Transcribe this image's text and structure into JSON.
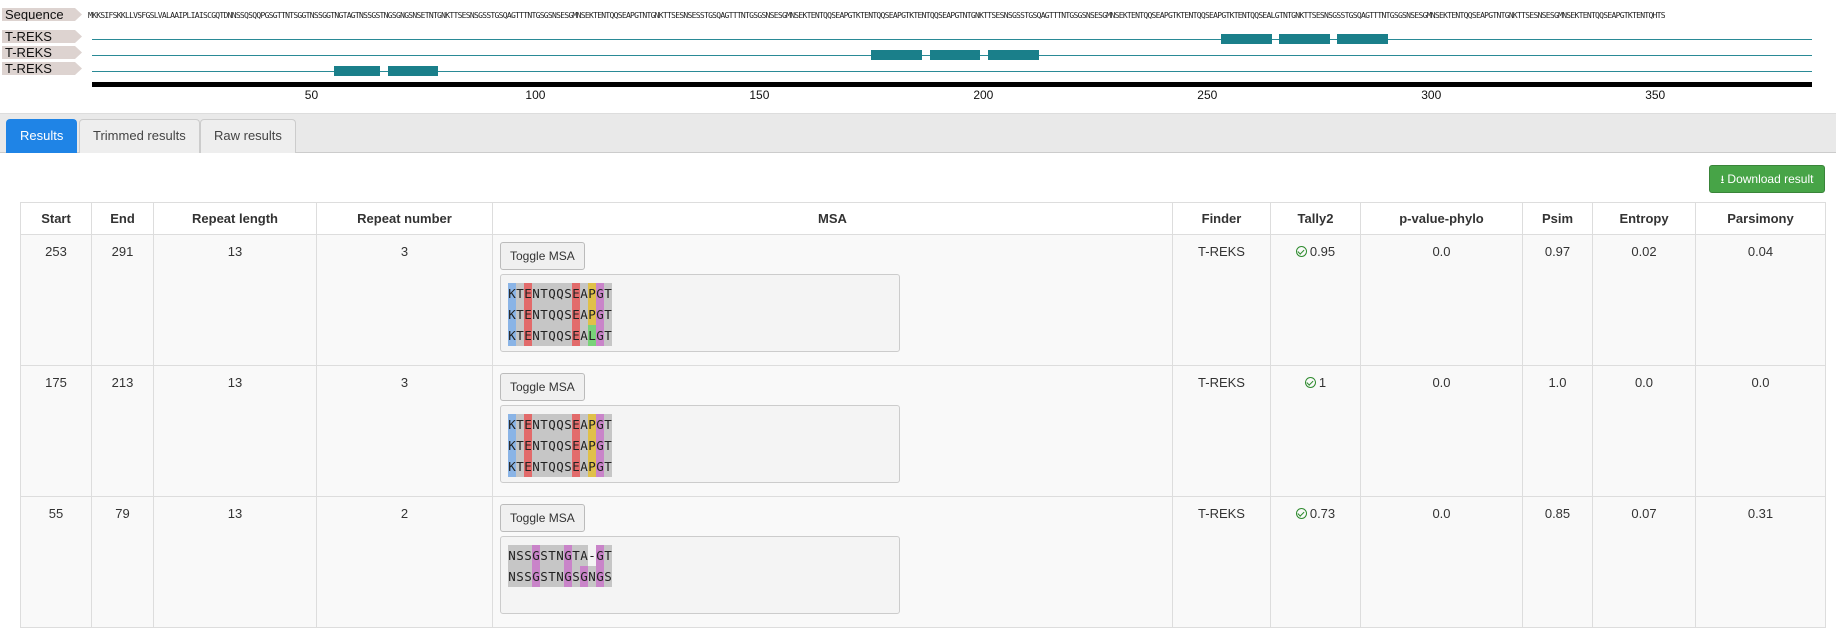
{
  "viewer": {
    "sequence_label": "Sequence",
    "sequence": "MKKSIFSKKLLVSFGSLVALAAIPLIAISCGQTDNNSSQSQQPGSGTTNTSGGTNSSGGTNGTAGTNSSGSTNGSGNGSNSETNTGNKTTSESNSGSSTGSQAGTTTNTGSGSNSESGMNSEKTENTQQSEAPGTNTGNKTTSESNSESSTGSQAGTTTNTGSGSNSESGMNSEKTENTQQSEAPGTKTENTQQSEAPGTKTENTQQSEAPGTNTGNKTTSESNSGSSTGSQAGTTTNTGSGSNSESGMNSEKTENTQQSEAPGTKTENTQQSEAPGTKTENTQQSEALGTNTGNKTTSESNSGSSTGSQAGTTTNTGSGSNSESGMNSEKTENTQQSEAPGTNTGNKTTSESNSESGMNSEKTENTQQSEAPGTKTENTQHTS",
    "tracks": [
      {
        "label": "T-REKS",
        "features": [
          [
            253,
            265
          ],
          [
            266,
            278
          ],
          [
            279,
            291
          ]
        ]
      },
      {
        "label": "T-REKS",
        "features": [
          [
            175,
            187
          ],
          [
            188,
            200
          ],
          [
            201,
            213
          ]
        ]
      },
      {
        "label": "T-REKS",
        "features": [
          [
            55,
            66
          ],
          [
            67,
            79
          ]
        ]
      }
    ],
    "axis": {
      "min": 1,
      "max": 385,
      "ticks": [
        50,
        100,
        150,
        200,
        250,
        300,
        350
      ]
    }
  },
  "tabs": [
    {
      "label": "Results",
      "active": true
    },
    {
      "label": "Trimmed results",
      "active": false
    },
    {
      "label": "Raw results",
      "active": false
    }
  ],
  "download_label": "Download result",
  "table": {
    "headers": [
      "Start",
      "End",
      "Repeat length",
      "Repeat number",
      "MSA",
      "Finder",
      "Tally2",
      "p-value-phylo",
      "Psim",
      "Entropy",
      "Parsimony"
    ],
    "toggle_label": "Toggle MSA",
    "rows": [
      {
        "start": "253",
        "end": "291",
        "repeat_length": "13",
        "repeat_number": "3",
        "msa": [
          "KTENTQQSEAPGT",
          "KTENTQQSEAPGT",
          "KTENTQQSEALGT"
        ],
        "finder": "T-REKS",
        "tally2": "0.95",
        "pvalue": "0.0",
        "psim": "0.97",
        "entropy": "0.02",
        "parsimony": "0.04"
      },
      {
        "start": "175",
        "end": "213",
        "repeat_length": "13",
        "repeat_number": "3",
        "msa": [
          "KTENTQQSEAPGT",
          "KTENTQQSEAPGT",
          "KTENTQQSEAPGT"
        ],
        "finder": "T-REKS",
        "tally2": "1",
        "pvalue": "0.0",
        "psim": "1.0",
        "entropy": "0.0",
        "parsimony": "0.0"
      },
      {
        "start": "55",
        "end": "79",
        "repeat_length": "13",
        "repeat_number": "2",
        "msa": [
          "NSSGSTNGTA-GT",
          "NSSGSTNGSGNGS"
        ],
        "finder": "T-REKS",
        "tally2": "0.73",
        "pvalue": "0.0",
        "psim": "0.85",
        "entropy": "0.07",
        "parsimony": "0.31"
      }
    ]
  },
  "colors": {
    "feature": "#1a7f8a",
    "track_line": "#2a8a96",
    "tab_active": "#1f84e6",
    "download": "#47a447",
    "tally_green": "#2e8b2e",
    "aa_K": "#8ab4e6",
    "aa_T": "#c6c6c6",
    "aa_E": "#e26b6b",
    "aa_N": "#c6c6c6",
    "aa_Q": "#c6c6c6",
    "aa_S": "#c6c6c6",
    "aa_A": "#c6c6c6",
    "aa_P": "#e0c04a",
    "aa_G": "#c984c9",
    "aa_L": "#79d279",
    "aa_gap": "#f4f4f4"
  }
}
